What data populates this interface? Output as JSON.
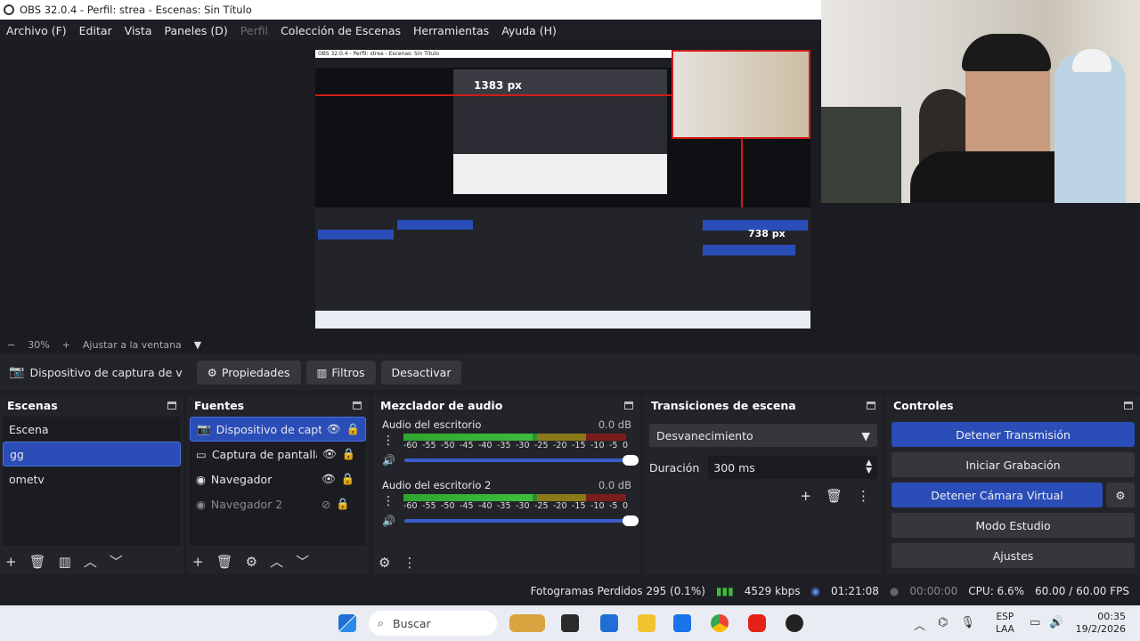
{
  "window": {
    "title": "OBS 32.0.4 - Perfil: strea - Escenas: Sin Título"
  },
  "menu": [
    "Archivo (F)",
    "Editar",
    "Vista",
    "Paneles (D)",
    "Perfil",
    "Colección de Escenas",
    "Herramientas",
    "Ayuda (H)"
  ],
  "preview": {
    "nested_title": "OBS 32.0.4 - Perfil: strea - Escenas: Sin Título",
    "measure_top": "1383 px",
    "measure_side": "738 px"
  },
  "zoombar": {
    "zoom": "30%",
    "fit": "Ajustar a la ventana"
  },
  "source_toolbar": {
    "source_name": "Dispositivo de captura de v",
    "properties": "Propiedades",
    "filters": "Filtros",
    "deactivate": "Desactivar"
  },
  "scenes": {
    "title": "Escenas",
    "items": [
      "Escena",
      "gg",
      "ometv"
    ],
    "selected_index": 1
  },
  "sources": {
    "title": "Fuentes",
    "items": [
      {
        "label": "Dispositivo de captur",
        "icon": "camera-icon",
        "visible": true,
        "selected": true
      },
      {
        "label": "Captura de pantalla",
        "icon": "monitor-icon",
        "visible": true,
        "selected": false
      },
      {
        "label": "Navegador",
        "icon": "globe-icon",
        "visible": true,
        "selected": false
      },
      {
        "label": "Navegador 2",
        "icon": "globe-icon",
        "visible": false,
        "selected": false
      }
    ]
  },
  "mixer": {
    "title": "Mezclador de audio",
    "channels": [
      {
        "name": "Audio del escritorio",
        "db": "0.0 dB",
        "level": 0.58
      },
      {
        "name": "Audio del escritorio 2",
        "db": "0.0 dB",
        "level": 0.58
      }
    ],
    "scale": [
      "-60",
      "-55",
      "-50",
      "-45",
      "-40",
      "-35",
      "-30",
      "-25",
      "-20",
      "-15",
      "-10",
      "-5",
      "0"
    ]
  },
  "transitions": {
    "title": "Transiciones de escena",
    "selected": "Desvanecimiento",
    "duration_label": "Duración",
    "duration_value": "300 ms"
  },
  "controls": {
    "title": "Controles",
    "buttons": [
      "Detener Transmisión",
      "Iniciar Grabación",
      "Detener Cámara Virtual",
      "Modo Estudio",
      "Ajustes"
    ]
  },
  "status": {
    "dropped": "Fotogramas Perdidos 295 (0.1%)",
    "bitrate": "4529 kbps",
    "stream_time": "01:21:08",
    "rec_time": "00:00:00",
    "cpu": "CPU: 6.6%",
    "fps": "60.00 / 60.00 FPS"
  },
  "taskbar": {
    "search": "Buscar",
    "lang_top": "ESP",
    "lang_bottom": "LAA",
    "time": "00:35",
    "date": "19/2/2026"
  },
  "colors": {
    "accent": "#2a4db8",
    "bg": "#1e1f24",
    "dock": "#23242a"
  }
}
